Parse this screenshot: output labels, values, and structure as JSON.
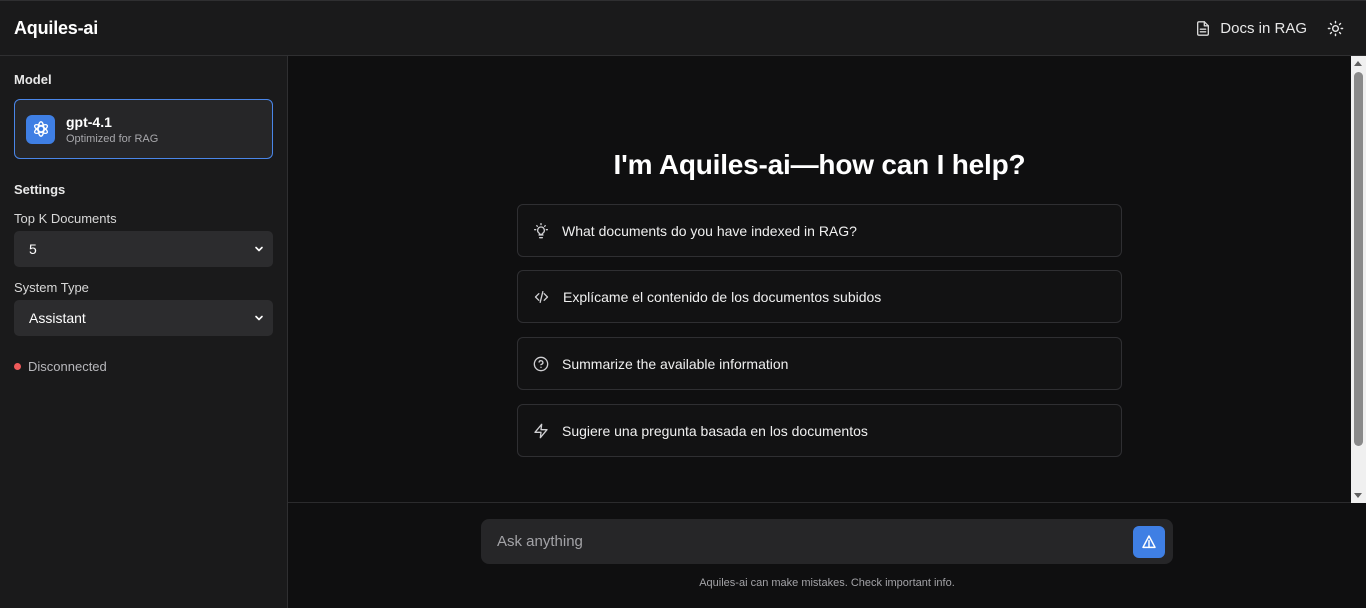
{
  "header": {
    "title": "Aquiles-ai",
    "docs_label": "Docs in RAG"
  },
  "sidebar": {
    "model_label": "Model",
    "model": {
      "name": "gpt-4.1",
      "description": "Optimized for RAG"
    },
    "settings_label": "Settings",
    "top_k": {
      "label": "Top K Documents",
      "value": "5"
    },
    "system_type": {
      "label": "System Type",
      "value": "Assistant"
    },
    "status": "Disconnected"
  },
  "main": {
    "heading": "I'm Aquiles-ai—how can I help?",
    "suggestions": [
      {
        "icon": "lightbulb-icon",
        "text": "What documents do you have indexed in RAG?"
      },
      {
        "icon": "code-icon",
        "text": "Explícame el contenido de los documentos subidos"
      },
      {
        "icon": "help-circle-icon",
        "text": "Summarize the available information"
      },
      {
        "icon": "zap-icon",
        "text": "Sugiere una pregunta basada en los documentos"
      }
    ],
    "composer": {
      "placeholder": "Ask anything"
    },
    "disclaimer": "Aquiles-ai can make mistakes. Check important info."
  },
  "colors": {
    "accent": "#3f7fe4",
    "background": "#0f0f10",
    "panel": "#1a1a1b",
    "status_disconnected": "#ef5a5a"
  }
}
